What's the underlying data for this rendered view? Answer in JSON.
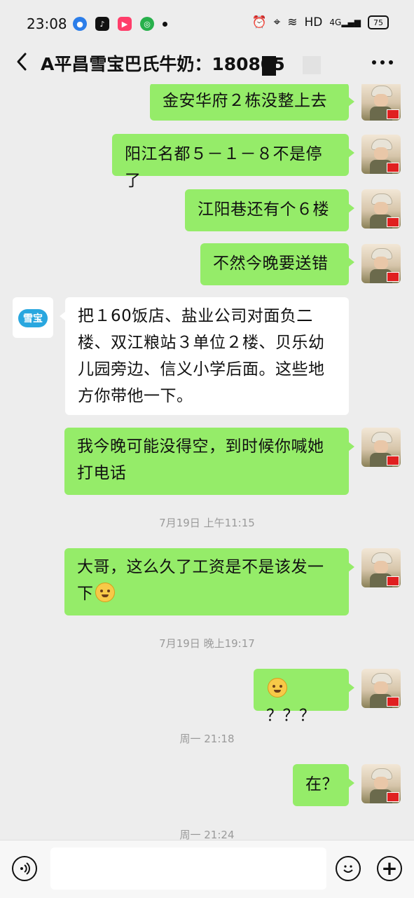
{
  "status": {
    "time": "23:08",
    "network": "HD",
    "signal": "4G",
    "battery": "75"
  },
  "header": {
    "title": "A平昌雪宝巴氏牛奶：180805"
  },
  "messages": [
    {
      "side": "me",
      "text": "金安华府２栋没整上去"
    },
    {
      "side": "me",
      "text": "阳江名都５－１－８不是停了"
    },
    {
      "side": "me",
      "text": "江阳巷还有个６楼"
    },
    {
      "side": "me",
      "text": "不然今晚要送错"
    },
    {
      "side": "them",
      "line1": "把１60饭店、盐业公司对面负二",
      "line2": "楼、双江粮站３单位２楼、贝乐幼",
      "line3": "儿园旁边、信义小学后面。这些地",
      "line4": "方你带他一下。",
      "avatar_text": "雪宝"
    },
    {
      "side": "me",
      "line1": "我今晚可能没得空，到时候你喊她",
      "line2": "打电话"
    },
    {
      "stamp": "7月19日 上午11:15"
    },
    {
      "side": "me",
      "line1": "大哥，这么久了工资是不是该发一",
      "line2": "下"
    },
    {
      "stamp": "7月19日 晚上19:17"
    },
    {
      "side": "me",
      "text": "？？？"
    },
    {
      "stamp": "周一 21:18"
    },
    {
      "side": "me",
      "text": "在？"
    },
    {
      "stamp": "周一 21:24"
    }
  ],
  "icons": {
    "back": "chevron-left-icon",
    "more": "more-dots-icon",
    "voice": "voice-icon",
    "emoji": "emoji-icon",
    "plus": "plus-icon"
  },
  "colors": {
    "bubble_me": "#95ec69",
    "bubble_them": "#ffffff",
    "background": "#ededed",
    "brand": "#29a7df"
  }
}
